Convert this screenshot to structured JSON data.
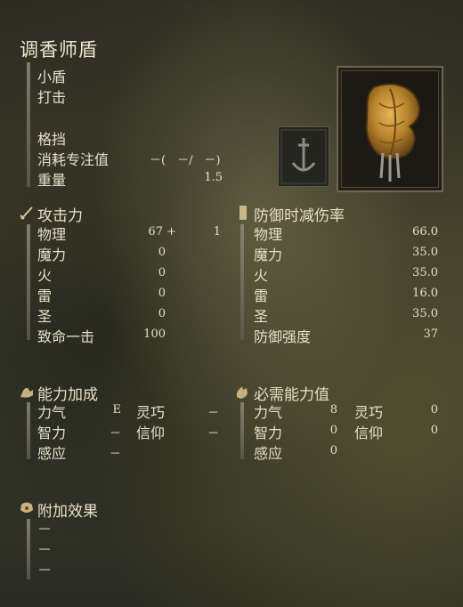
{
  "item": {
    "name": "调香师盾",
    "weapon_type": "小盾",
    "damage_type": "打击",
    "skill_label": "格挡",
    "fp_cost_label": "消耗专注值",
    "fp_cost_value": "－(　－/　－)",
    "weight_label": "重量",
    "weight_value": "1.5"
  },
  "attack": {
    "header": "攻击力",
    "rows": [
      {
        "label": "物理",
        "value": "67 +",
        "extra": "1"
      },
      {
        "label": "魔力",
        "value": "0"
      },
      {
        "label": "火",
        "value": "0"
      },
      {
        "label": "雷",
        "value": "0"
      },
      {
        "label": "圣",
        "value": "0"
      },
      {
        "label": "致命一击",
        "value": "100"
      }
    ]
  },
  "guard": {
    "header": "防御时减伤率",
    "rows": [
      {
        "label": "物理",
        "value": "66.0"
      },
      {
        "label": "魔力",
        "value": "35.0"
      },
      {
        "label": "火",
        "value": "35.0"
      },
      {
        "label": "雷",
        "value": "16.0"
      },
      {
        "label": "圣",
        "value": "35.0"
      },
      {
        "label": "防御强度",
        "value": "37"
      }
    ]
  },
  "scaling": {
    "header": "能力加成",
    "str_label": "力气",
    "str_value": "E",
    "dex_label": "灵巧",
    "dex_value": "－",
    "int_label": "智力",
    "int_value": "－",
    "fai_label": "信仰",
    "fai_value": "－",
    "arc_label": "感应",
    "arc_value": "－"
  },
  "requirements": {
    "header": "必需能力值",
    "str_label": "力气",
    "str_value": "8",
    "dex_label": "灵巧",
    "dex_value": "0",
    "int_label": "智力",
    "int_value": "0",
    "fai_label": "信仰",
    "fai_value": "0",
    "arc_label": "感应",
    "arc_value": "0"
  },
  "passive": {
    "header": "附加效果",
    "effects": [
      "－",
      "－",
      "－"
    ]
  },
  "icons": {
    "attack": "sword-icon",
    "guard": "shield-icon",
    "scaling": "flexed-arm-icon",
    "requirements": "hand-icon",
    "passive": "effect-icon",
    "skill": "sword-stance-icon",
    "item": "perfumer-shield-icon"
  },
  "colors": {
    "text": "#e6dfca",
    "frame": "#6e6550",
    "shield_gold": "#b8842c"
  }
}
